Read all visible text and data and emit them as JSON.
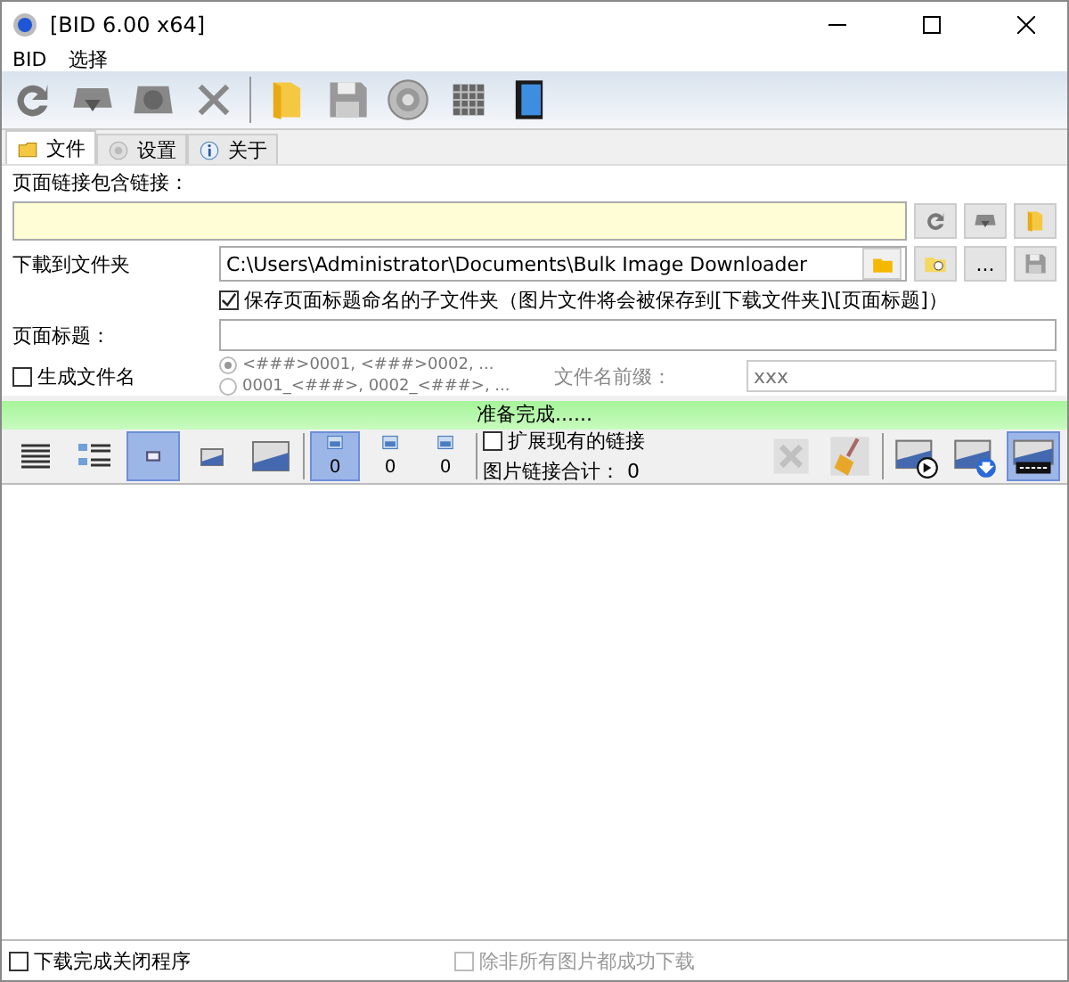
{
  "window": {
    "title": "[BID 6.00 x64]"
  },
  "menu": [
    "BID",
    "选择"
  ],
  "tabs": [
    {
      "label": "文件",
      "selected": true
    },
    {
      "label": "设置",
      "selected": false
    },
    {
      "label": "关于",
      "selected": false
    }
  ],
  "form": {
    "url_label": "页面链接包含链接：",
    "folder": {
      "label": "下載到文件夹",
      "value": "C:\\Users\\Administrator\\Documents\\Bulk Image Downloader",
      "browse_button": "..."
    },
    "subfolder": {
      "label": "保存页面标题命名的子文件夹（图片文件将会被保存到[下载文件夹]\\[页面标题]）",
      "checked": true
    },
    "page_title": {
      "label": "页面标题："
    },
    "generate": {
      "label": "生成文件名",
      "checked": false
    },
    "name_patterns": [
      {
        "label": "<###>0001, <###>0002, ...",
        "selected": true
      },
      {
        "label": "0001_<###>, 0002_<###>, ...",
        "selected": false
      }
    ],
    "prefix": {
      "label": "文件名前缀：",
      "placeholder": "xxx"
    }
  },
  "status": "准备完成......",
  "view_buttons": [
    {
      "selected": false
    },
    {
      "selected": false
    },
    {
      "selected": true
    },
    {
      "selected": false
    },
    {
      "selected": false
    }
  ],
  "counters": [
    {
      "count": "0",
      "selected": true
    },
    {
      "count": "0",
      "selected": false
    },
    {
      "count": "0",
      "selected": false
    }
  ],
  "extend_links": {
    "label": "扩展现有的链接",
    "checked": false
  },
  "total": {
    "label": "图片链接合计：",
    "value": "0"
  },
  "action_buttons": [
    {
      "disabled": true,
      "selected": false
    },
    {
      "disabled": false,
      "selected": false
    },
    {
      "disabled": false,
      "selected": false
    },
    {
      "disabled": false,
      "selected": false
    },
    {
      "disabled": false,
      "selected": true
    }
  ],
  "bottom": {
    "close_on_done": {
      "label": "下载完成关闭程序",
      "checked": false
    },
    "unless_all": {
      "label": "除非所有图片都成功下载",
      "checked": false,
      "disabled": true
    }
  }
}
